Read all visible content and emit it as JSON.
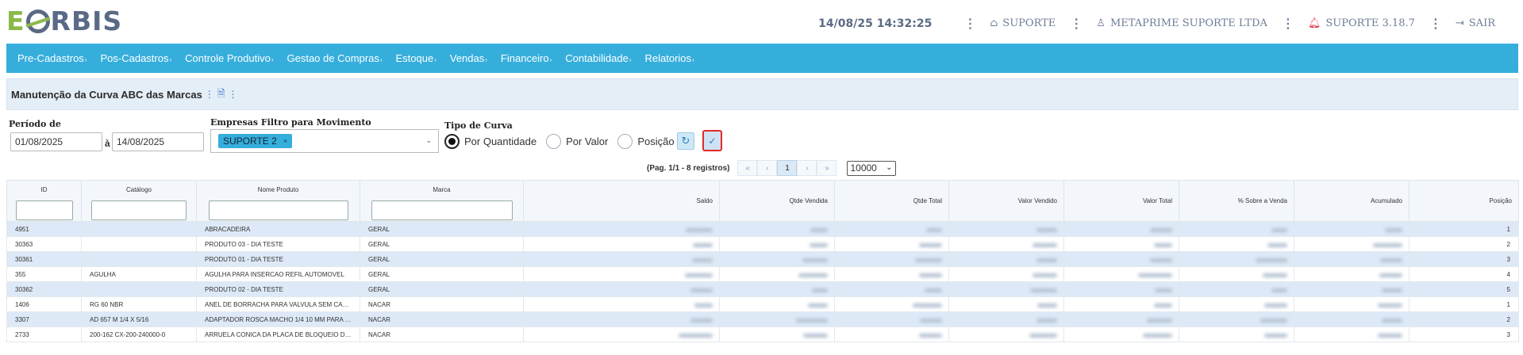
{
  "header": {
    "logo_text_e": "E",
    "logo_text_rest": "RBIS",
    "datetime": "14/08/25 14:32:25",
    "suporte": "SUPORTE",
    "company": "METAPRIME SUPORTE LTDA",
    "version": "SUPORTE 3.18.7",
    "logout": "SAIR"
  },
  "menu": [
    "Pre-Cadastros",
    "Pos-Cadastros",
    "Controle Produtivo",
    "Gestao de Compras",
    "Estoque",
    "Vendas",
    "Financeiro",
    "Contabilidade",
    "Relatorios"
  ],
  "page": {
    "title": "Manutenção da Curva ABC das Marcas"
  },
  "filters": {
    "periodo_label": "Período de",
    "date_from": "01/08/2025",
    "ate_label": "à",
    "date_to": "14/08/2025",
    "empresas_label": "Empresas Filtro para Movimento",
    "empresa_chip": "SUPORTE 2",
    "tipo_label": "Tipo de Curva",
    "radio_options": [
      "Por Quantidade",
      "Por Valor",
      "Posição"
    ],
    "selected_radio": "Por Quantidade"
  },
  "pager": {
    "info": "(Pag. 1/1 - 8 registros)",
    "first": "«",
    "prev": "‹",
    "current": "1",
    "next": "›",
    "last": "»",
    "page_size": "10000"
  },
  "grid": {
    "columns": [
      "ID",
      "Catálogo",
      "Nome Produto",
      "Marca",
      "Saldo",
      "Qtde Vendida",
      "Qtde Total",
      "Valor Vendido",
      "Valor Total",
      "% Sobre a Venda",
      "Acumulado",
      "Posição"
    ],
    "rows": [
      {
        "id": "4951",
        "catalogo": "",
        "nome": "ABRACADEIRA",
        "marca": "GERAL",
        "posicao": "1"
      },
      {
        "id": "30363",
        "catalogo": "",
        "nome": "PRODUTO 03 - DIA TESTE",
        "marca": "GERAL",
        "posicao": "2"
      },
      {
        "id": "30361",
        "catalogo": "",
        "nome": "PRODUTO 01 - DIA TESTE",
        "marca": "GERAL",
        "posicao": "3"
      },
      {
        "id": "355",
        "catalogo": "AGULHA",
        "nome": "AGULHA PARA INSERCAO REFIL AUTOMOVEL",
        "marca": "GERAL",
        "posicao": "4"
      },
      {
        "id": "30362",
        "catalogo": "",
        "nome": "PRODUTO 02 - DIA TESTE",
        "marca": "GERAL",
        "posicao": "5"
      },
      {
        "id": "1406",
        "catalogo": "RG 60 NBR",
        "nome": "ANEL DE BORRACHA PARA VALVULA SEM CAMAR...",
        "marca": "NACAR",
        "posicao": "1"
      },
      {
        "id": "3307",
        "catalogo": "AD 657 M 1/4 X 5/16",
        "nome": "ADAPTADOR ROSCA MACHO 1/4 10 MM PARA M...",
        "marca": "NACAR",
        "posicao": "2"
      },
      {
        "id": "2733",
        "catalogo": "200-162 CX-200-240000-0",
        "nome": "ARRUELA CONICA DA PLACA DE BLOQUEIO DO B...",
        "marca": "NACAR",
        "posicao": "3"
      }
    ]
  }
}
